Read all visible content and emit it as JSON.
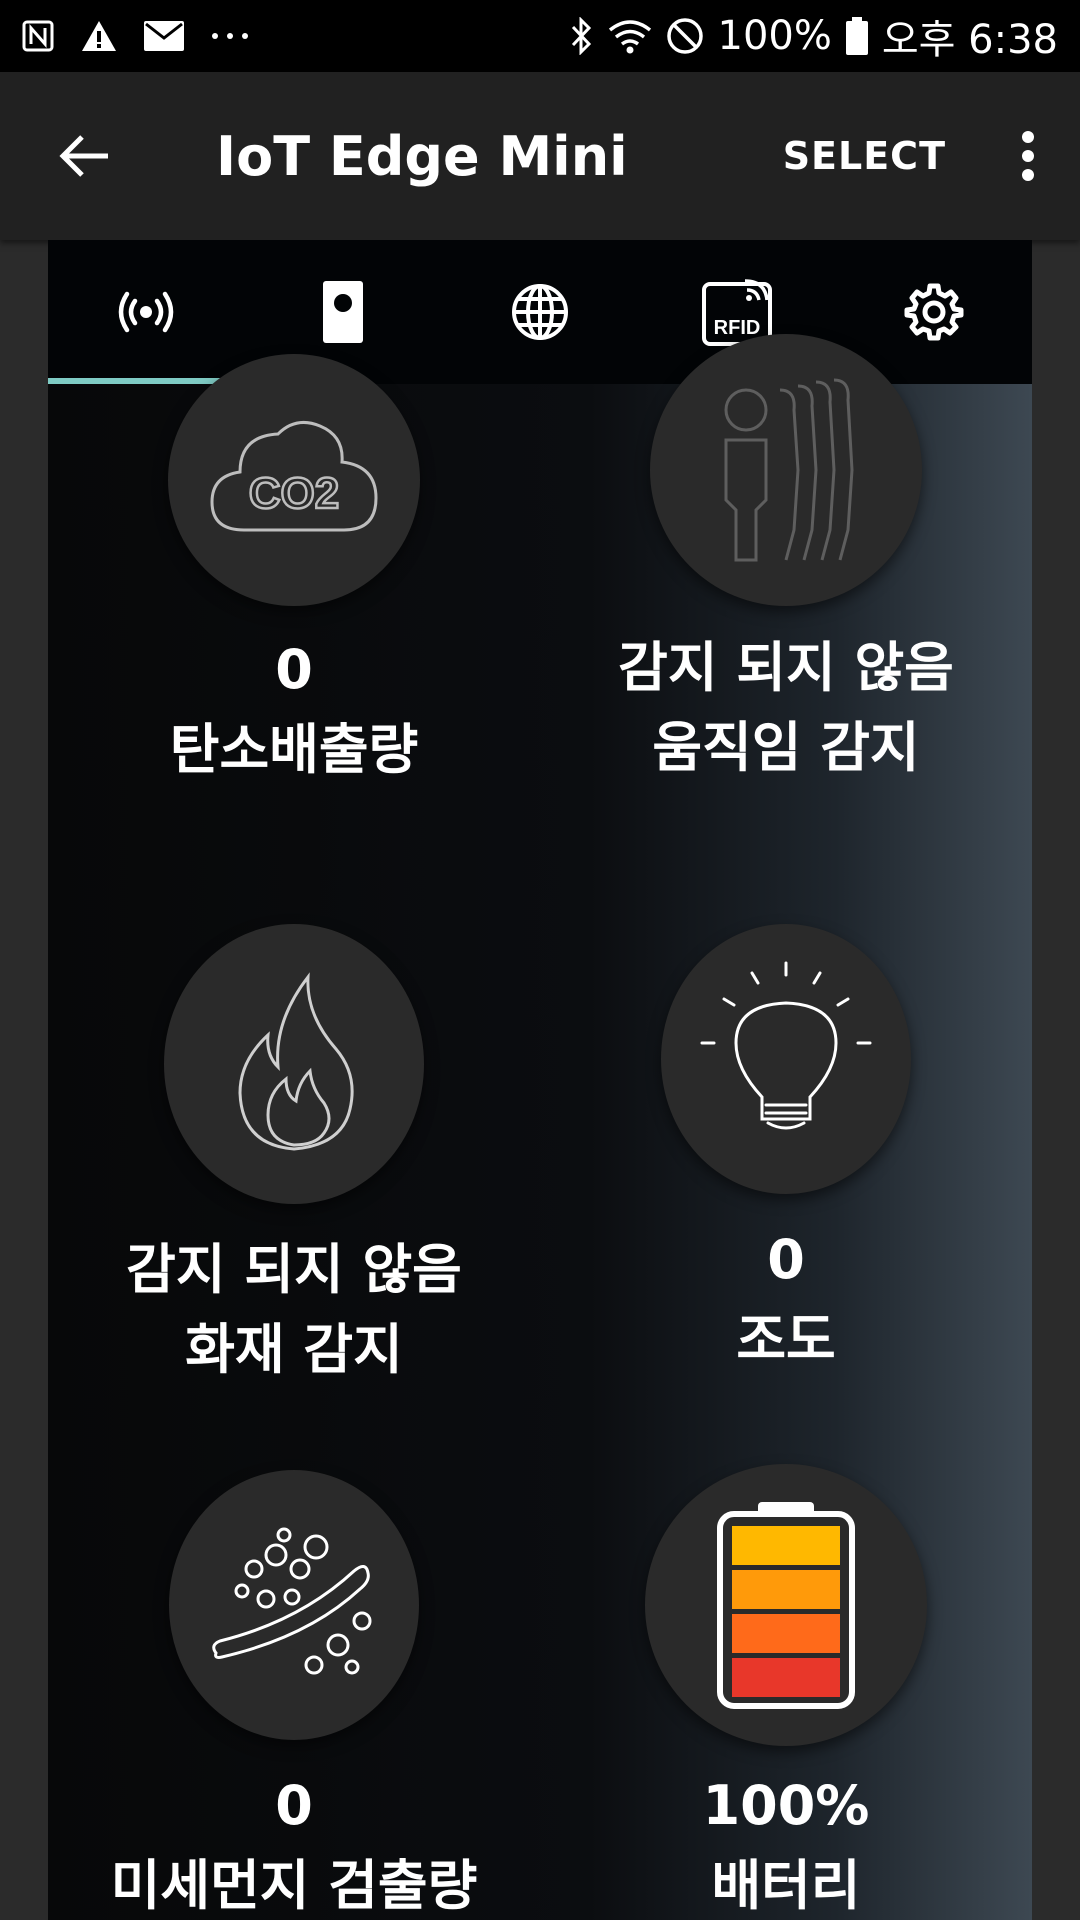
{
  "status_bar": {
    "battery": "100%",
    "time": "오후 6:38",
    "icons": [
      "nfc-icon",
      "warning-icon",
      "mail-icon",
      "more-dots-icon",
      "bluetooth-icon",
      "wifi-icon",
      "dnd-icon",
      "battery-icon"
    ]
  },
  "app_bar": {
    "title": "IoT Edge Mini",
    "select_label": "SELECT"
  },
  "tabs": [
    "broadcast-icon",
    "device-icon",
    "globe-icon",
    "rfid-icon",
    "gear-icon"
  ],
  "tabs_text": {
    "rfid": "RFID"
  },
  "sensors": [
    {
      "value": "0",
      "label": "탄소배출량",
      "icon": "co2-cloud-icon",
      "icon_text": "CO2"
    },
    {
      "value": "감지 되지 않음",
      "label": "움직임 감지",
      "icon": "motion-person-icon"
    },
    {
      "value": "감지 되지 않음",
      "label": "화재 감지",
      "icon": "flame-icon"
    },
    {
      "value": "0",
      "label": "조도",
      "icon": "light-bulb-icon"
    },
    {
      "value": "0",
      "label": "미세먼지 검출량",
      "icon": "dust-particles-icon"
    },
    {
      "value": "100%",
      "label": "배터리",
      "icon": "battery-level-icon",
      "battery_level": 1.0
    }
  ],
  "colors": {
    "accent": "#7fcbc4",
    "battery_bars": [
      "#ffb800",
      "#ff9a0a",
      "#ff6a1a",
      "#e8372a"
    ]
  }
}
